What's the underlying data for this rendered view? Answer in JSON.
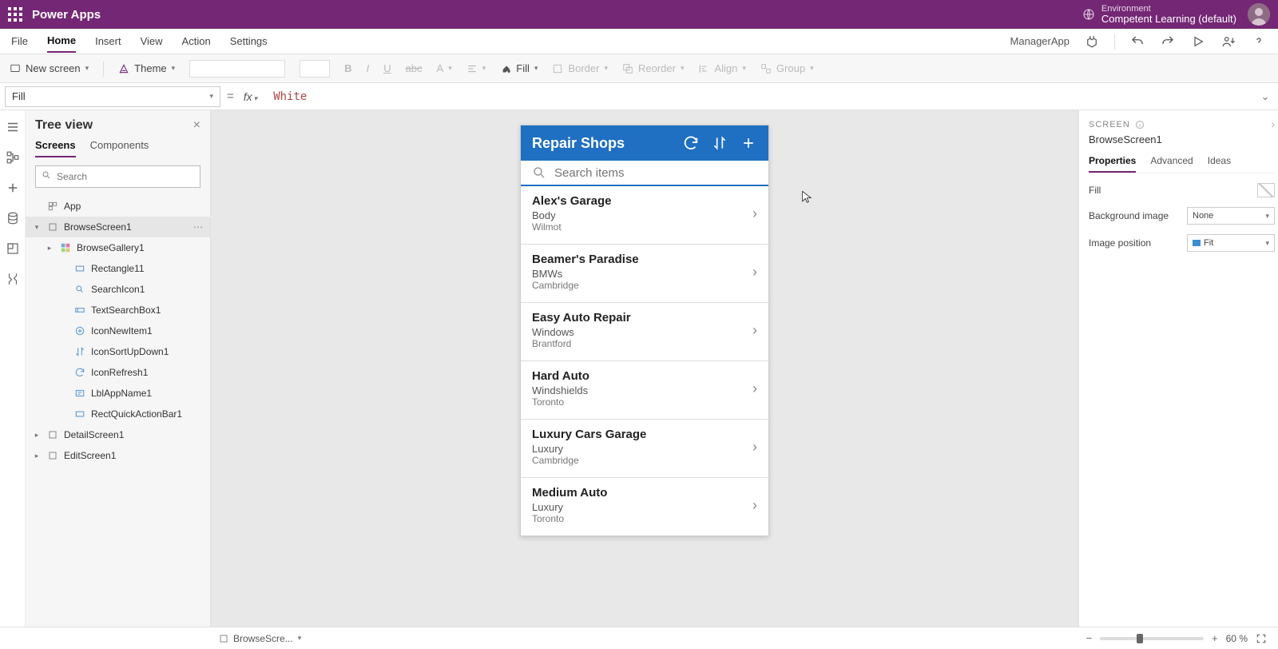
{
  "header": {
    "app_title": "Power Apps",
    "environment_label": "Environment",
    "environment_name": "Competent Learning (default)"
  },
  "menu": {
    "items": [
      "File",
      "Home",
      "Insert",
      "View",
      "Action",
      "Settings"
    ],
    "active_index": 1,
    "app_name": "ManagerApp"
  },
  "toolbar": {
    "new_screen": "New screen",
    "theme": "Theme",
    "fill": "Fill",
    "border": "Border",
    "reorder": "Reorder",
    "align": "Align",
    "group": "Group"
  },
  "formula": {
    "property": "Fill",
    "value": "White"
  },
  "tree": {
    "title": "Tree view",
    "tabs": [
      "Screens",
      "Components"
    ],
    "active_tab": 0,
    "search_placeholder": "Search",
    "nodes": {
      "app": "App",
      "browse_screen": "BrowseScreen1",
      "browse_gallery": "BrowseGallery1",
      "rectangle": "Rectangle11",
      "search_icon": "SearchIcon1",
      "text_search_box": "TextSearchBox1",
      "icon_new_item": "IconNewItem1",
      "icon_sort": "IconSortUpDown1",
      "icon_refresh": "IconRefresh1",
      "lbl_app_name": "LblAppName1",
      "rect_quick_action": "RectQuickActionBar1",
      "detail_screen": "DetailScreen1",
      "edit_screen": "EditScreen1"
    }
  },
  "phone": {
    "title": "Repair Shops",
    "search_placeholder": "Search items",
    "items": [
      {
        "title": "Alex's Garage",
        "sub1": "Body",
        "sub2": "Wilmot"
      },
      {
        "title": "Beamer's Paradise",
        "sub1": "BMWs",
        "sub2": "Cambridge"
      },
      {
        "title": "Easy Auto Repair",
        "sub1": "Windows",
        "sub2": "Brantford"
      },
      {
        "title": "Hard Auto",
        "sub1": "Windshields",
        "sub2": "Toronto"
      },
      {
        "title": "Luxury Cars Garage",
        "sub1": "Luxury",
        "sub2": "Cambridge"
      },
      {
        "title": "Medium Auto",
        "sub1": "Luxury",
        "sub2": "Toronto"
      }
    ]
  },
  "props": {
    "type_label": "SCREEN",
    "element_name": "BrowseScreen1",
    "tabs": [
      "Properties",
      "Advanced",
      "Ideas"
    ],
    "active_tab": 0,
    "fill_label": "Fill",
    "bg_image_label": "Background image",
    "bg_image_value": "None",
    "img_pos_label": "Image position",
    "img_pos_value": "Fit"
  },
  "status": {
    "crumb": "BrowseScre...",
    "zoom_value": "60",
    "zoom_pct": "%"
  }
}
